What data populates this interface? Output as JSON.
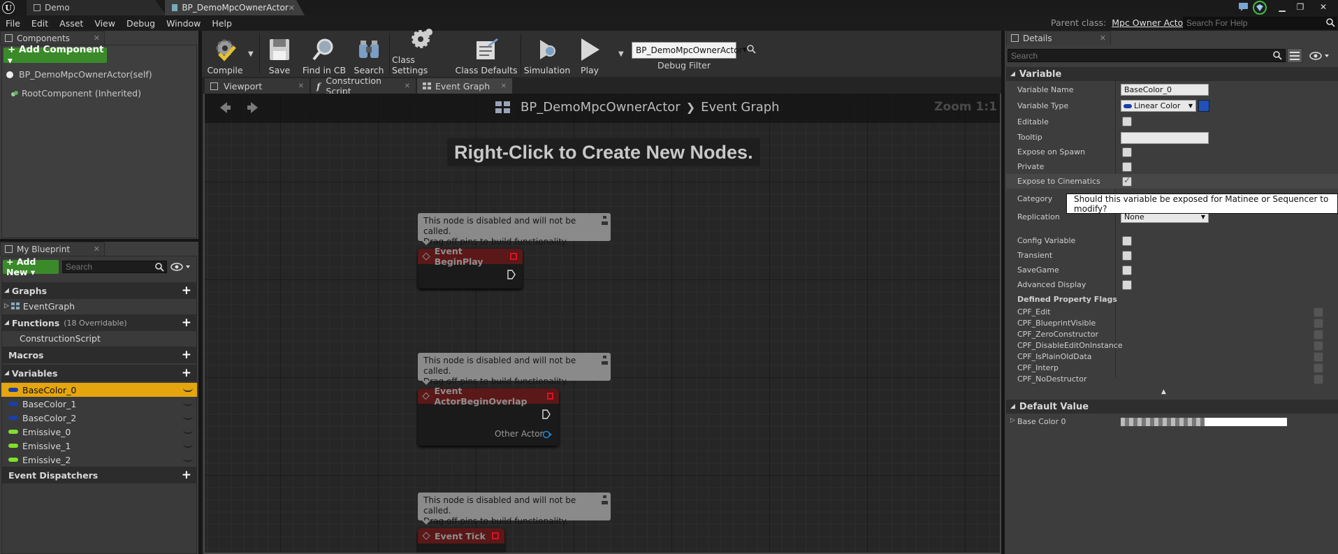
{
  "titlebar": {
    "tabs": [
      {
        "label": "Demo"
      },
      {
        "label": "BP_DemoMpcOwnerActor"
      }
    ]
  },
  "menubar": {
    "items": [
      "File",
      "Edit",
      "Asset",
      "View",
      "Debug",
      "Window",
      "Help"
    ],
    "parent_class_label": "Parent class:",
    "parent_class_value": "Mpc Owner Actor",
    "help_search_placeholder": "Search For Help"
  },
  "components": {
    "tab_label": "Components",
    "add_button": "+ Add Component ▾",
    "items": [
      "BP_DemoMpcOwnerActor(self)",
      "RootComponent (Inherited)"
    ]
  },
  "my_blueprint": {
    "tab_label": "My Blueprint",
    "add_new": "+ Add New ▾",
    "search_placeholder": "Search",
    "graphs_label": "Graphs",
    "graph_items": [
      "EventGraph"
    ],
    "functions_label": "Functions",
    "functions_count": "(18 Overridable)",
    "function_items": [
      "ConstructionScript"
    ],
    "macros_label": "Macros",
    "variables_label": "Variables",
    "variables": [
      {
        "name": "BaseColor_0",
        "type_color": "#1a3fa8",
        "selected": true
      },
      {
        "name": "BaseColor_1",
        "type_color": "#1a3fa8",
        "selected": false
      },
      {
        "name": "BaseColor_2",
        "type_color": "#1a3fa8",
        "selected": false
      },
      {
        "name": "Emissive_0",
        "type_color": "#7fe02a",
        "selected": false
      },
      {
        "name": "Emissive_1",
        "type_color": "#7fe02a",
        "selected": false
      },
      {
        "name": "Emissive_2",
        "type_color": "#7fe02a",
        "selected": false
      }
    ],
    "event_dispatchers_label": "Event Dispatchers"
  },
  "toolbar": {
    "compile": "Compile",
    "save": "Save",
    "find_in_cb": "Find in CB",
    "search": "Search",
    "class_settings": "Class Settings",
    "class_defaults": "Class Defaults",
    "simulation": "Simulation",
    "play": "Play",
    "debug_filter_value": "BP_DemoMpcOwnerActor",
    "debug_filter_label": "Debug Filter"
  },
  "graph_tabs": [
    "Viewport",
    "Construction Script",
    "Event Graph"
  ],
  "graph": {
    "breadcrumb_root": "BP_DemoMpcOwnerActor",
    "breadcrumb_leaf": "Event Graph",
    "zoom": "Zoom 1:1",
    "hint": "Right-Click to Create New Nodes.",
    "comment_line1": "This node is disabled and will not be called.",
    "comment_line2": "Drag off pins to build functionality.",
    "nodes": [
      {
        "title": "Event BeginPlay"
      },
      {
        "title": "Event ActorBeginOverlap",
        "pin": "Other Actor"
      },
      {
        "title": "Event Tick"
      }
    ]
  },
  "details": {
    "tab_label": "Details",
    "search_placeholder": "Search",
    "variable_section": "Variable",
    "variable_name_label": "Variable Name",
    "variable_name_value": "BaseColor_0",
    "variable_type_label": "Variable Type",
    "variable_type_value": "Linear Color",
    "editable": "Editable",
    "tooltip_label": "Tooltip",
    "expose_on_spawn": "Expose on Spawn",
    "private": "Private",
    "expose_to_cinematics": "Expose to Cinematics",
    "category": "Category",
    "replication": "Replication",
    "replication_value": "None",
    "config_variable": "Config Variable",
    "transient": "Transient",
    "savegame": "SaveGame",
    "advanced_display": "Advanced Display",
    "flags_label": "Defined Property Flags",
    "flags": [
      "CPF_Edit",
      "CPF_BlueprintVisible",
      "CPF_ZeroConstructor",
      "CPF_DisableEditOnInstance",
      "CPF_IsPlainOldData",
      "CPF_Interp",
      "CPF_NoDestructor"
    ],
    "default_value_section": "Default Value",
    "base_color_label": "Base Color 0",
    "tooltip_popup": "Should this variable be exposed for Matinee or Sequencer to modify?"
  }
}
